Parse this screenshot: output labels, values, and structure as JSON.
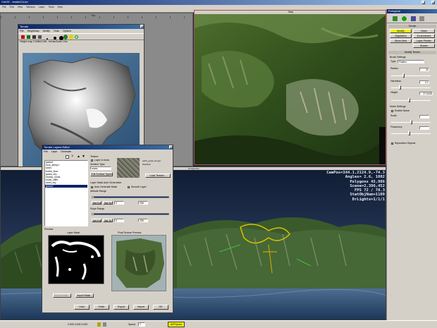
{
  "app": {
    "title": "CtrlGE - testdbCA.ter",
    "menu": [
      "File",
      "Edit",
      "View",
      "Window",
      "Layer",
      "Tools",
      "Help"
    ]
  },
  "top_view": {
    "label": "Top"
  },
  "terrain_window": {
    "title": "Terrain",
    "menu": [
      "File",
      "Heightmap",
      "Modify",
      "Tools",
      "Options"
    ],
    "info": "Height map 2,048x2,048 - terrainScale 10m",
    "status": [
      "X: 2042",
      "Y: 1980"
    ]
  },
  "map_view": {
    "label": "Map"
  },
  "perspective_view": {
    "label": "Perspective"
  },
  "hud": {
    "campos": "CamPos=344.1,2124.9,-74.3",
    "angles": "Angles=  2.6, 1002",
    "polygons": "Polygons 45,986",
    "scene": "Scene=2,396,452",
    "fps": "FPS  72 / 78.3",
    "static": "StatObjNum=1109",
    "drlights": "DrLights=1/1/1"
  },
  "layers_editor": {
    "title": "Terrain Layers Editor",
    "menu": [
      "File",
      "Layer",
      "Generate"
    ],
    "layers": [
      "grass1",
      "rock_steep1",
      "sand",
      "forest_floor",
      "grass_dry",
      "mossy_rocks",
      "snow_cliffs",
      "sand_dry",
      "grass2"
    ],
    "selected_index": 8,
    "props": {
      "texture_label": "Texture",
      "use_in_draw_label": "Layer in draw",
      "surface_type_label": "Surface Type",
      "surface_type_value": "grass",
      "edit_surface_types": "Edit Surface Types",
      "texture_file": "earth_grass_01.tga",
      "texture_size": "512x512",
      "load_texture": "Load Texture...",
      "auto_gen_label": "Layer Mask Auto Generation",
      "auto_gen_mask": "Auto Generate Mask",
      "smooth_layer": "Smooth Layer",
      "altitude_label": "Altitude Range",
      "slope_label": "Slope Range",
      "set_from": "Set Fro",
      "set_to": "Set To",
      "alt_from": "0",
      "alt_to": "256",
      "slope_from": "0",
      "slope_to": "255",
      "alt_from_pct": 0.02,
      "alt_to_pct": 1.0,
      "slope_from_pct": 0.02,
      "slope_to_pct": 1.0
    },
    "preview_label": "Preview",
    "layer_mask_label": "Layer Mask",
    "final_texture_label": "Final Texture Preview",
    "layer_actions": [
      "Export Mask...",
      "Import Mask..."
    ],
    "bottom_buttons": [
      "Hold",
      "Fetch",
      "Export",
      "Import",
      "OK"
    ]
  },
  "rollup": {
    "title": "Rollupbar",
    "section_terrain": "Terrain",
    "tabs": [
      "Modify",
      "Holes",
      "Vegetation",
      "Environment",
      "Move Area",
      "Layer Painter",
      "Shader"
    ],
    "section_modify": "Modify Terrain",
    "brush_settings": "Brush Settings",
    "type_label": "Type",
    "type_value": "Flatten",
    "radius_label": "Radius",
    "radius_value": "32",
    "hardness_label": "Hardness",
    "hardness_value": "0.2",
    "height_label": "Height",
    "height_value": "37.5438",
    "noise_settings": "Noise Settings",
    "enable_noise": "Enable Noise",
    "scale_label": "Scale",
    "frequency_label": "Frequency",
    "reposition_objects": "Reposition Objects",
    "radius_pct": 0.3,
    "hardness_pct": 0.2,
    "height_pct": 0.45,
    "scale_pct": 0.5,
    "frequency_pct": 0.45
  },
  "status_bar": {
    "speed_label": "Speed",
    "speed_value": "1",
    "ai_physics": "AI/Physics",
    "coords": "0.000   0.000   0.000"
  }
}
